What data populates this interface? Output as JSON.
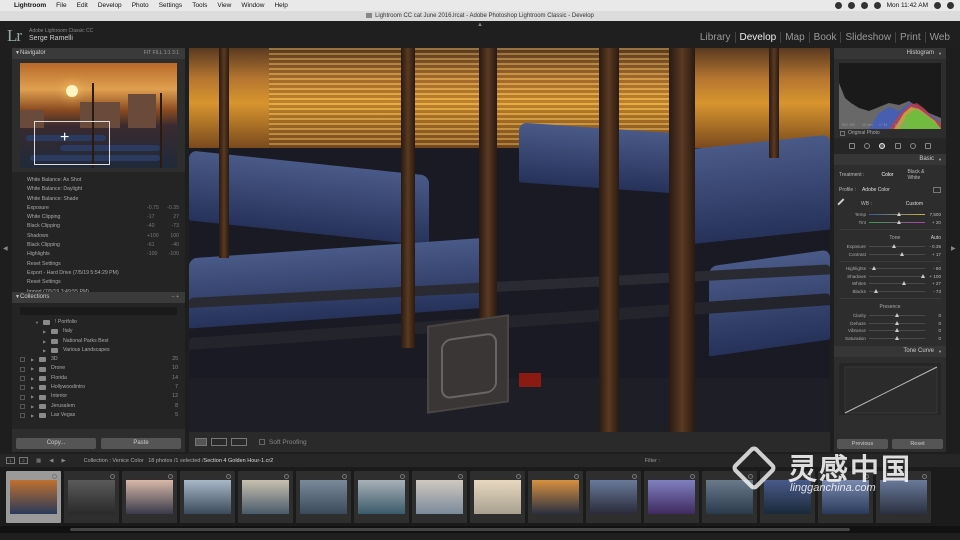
{
  "menubar": {
    "app": "Lightroom",
    "items": [
      "File",
      "Edit",
      "Develop",
      "Photo",
      "Settings",
      "Tools",
      "View",
      "Window",
      "Help"
    ],
    "clock": "Mon 11:42 AM"
  },
  "window": {
    "title": "Lightroom CC cat June 2016.lrcat - Adobe Photoshop Lightroom Classic - Develop"
  },
  "identity": {
    "logo": "Lr",
    "product": "Adobe Lightroom Classic CC",
    "user": "Serge Ramelli"
  },
  "modules": [
    "Library",
    "Develop",
    "Map",
    "Book",
    "Slideshow",
    "Print",
    "Web"
  ],
  "active_module": "Develop",
  "navigator": {
    "title": "Navigator",
    "zoom_options": "FIT  FILL  1:1  3:1"
  },
  "history": [
    {
      "label": "White Balance: As Shot",
      "a": "",
      "b": ""
    },
    {
      "label": "White Balance: Daylight",
      "a": "",
      "b": ""
    },
    {
      "label": "White Balance: Shade",
      "a": "",
      "b": ""
    },
    {
      "label": "Exposure",
      "a": "-0.75",
      "b": "-0.35"
    },
    {
      "label": "White Clipping",
      "a": "-17",
      "b": "27"
    },
    {
      "label": "Black Clipping",
      "a": "-40",
      "b": "-73"
    },
    {
      "label": "Shadows",
      "a": "+100",
      "b": "100"
    },
    {
      "label": "Black Clipping",
      "a": "-61",
      "b": "-40"
    },
    {
      "label": "Highlights",
      "a": "-100",
      "b": "-100"
    },
    {
      "label": "Reset Settings",
      "a": "",
      "b": ""
    },
    {
      "label": "Export - Hard Drive (7/5/19 5:54:29 PM)",
      "a": "",
      "b": ""
    },
    {
      "label": "Reset Settings",
      "a": "",
      "b": ""
    },
    {
      "label": "Import (7/5/19 3:49:55 PM)",
      "a": "",
      "b": ""
    }
  ],
  "collections": {
    "title": "Collections",
    "items": [
      {
        "label": "! Portfolio",
        "count": "",
        "level": 0
      },
      {
        "label": "Italy",
        "count": "",
        "level": 1
      },
      {
        "label": "National Parks Best",
        "count": "",
        "level": 1
      },
      {
        "label": "Various Landscapes",
        "count": "",
        "level": 1
      },
      {
        "label": "3D",
        "count": "25",
        "level": 1
      },
      {
        "label": "Drone",
        "count": "10",
        "level": 1
      },
      {
        "label": "Florida",
        "count": "14",
        "level": 1
      },
      {
        "label": "Hollywoodintro",
        "count": "7",
        "level": 1
      },
      {
        "label": "Interior",
        "count": "12",
        "level": 1
      },
      {
        "label": "Jerusalem",
        "count": "8",
        "level": 1
      },
      {
        "label": "Las Vegas",
        "count": "5",
        "level": 1
      }
    ]
  },
  "left_buttons": {
    "copy": "Copy...",
    "paste": "Paste"
  },
  "toolbar": {
    "soft_proofing": "Soft Proofing"
  },
  "histogram": {
    "title": "Histogram",
    "iso": "ISO 160",
    "focal": "24 mm",
    "aperture": "f / 14",
    "shutter": "1/60 SEC",
    "original_photo": "Original Photo"
  },
  "basic": {
    "title": "Basic",
    "treatment_label": "Treatment :",
    "treatment_color": "Color",
    "treatment_bw": "Black & White",
    "profile_label": "Profile :",
    "profile_value": "Adobe Color",
    "wb_label": "WB :",
    "wb_value": "Custom",
    "temp": {
      "label": "Temp",
      "value": "7,500",
      "pos": 0.55
    },
    "tint": {
      "label": "Tint",
      "value": "+ 20",
      "pos": 0.55
    },
    "tone_label": "Tone",
    "tone_auto": "Auto",
    "exposure": {
      "label": "Exposure",
      "value": "- 0.35",
      "pos": 0.46
    },
    "contrast": {
      "label": "Contrast",
      "value": "+ 17",
      "pos": 0.6
    },
    "highlights": {
      "label": "Highlights",
      "value": "- 80",
      "pos": 0.1
    },
    "shadows": {
      "label": "Shadows",
      "value": "+ 100",
      "pos": 0.98
    },
    "whites": {
      "label": "Whites",
      "value": "+ 27",
      "pos": 0.64
    },
    "blacks": {
      "label": "Blacks",
      "value": "- 73",
      "pos": 0.14
    },
    "presence_label": "Presence",
    "clarity": {
      "label": "Clarity",
      "value": "0",
      "pos": 0.5
    },
    "dehaze": {
      "label": "Dehaze",
      "value": "0",
      "pos": 0.5
    },
    "vibrance": {
      "label": "Vibrance",
      "value": "0",
      "pos": 0.5
    },
    "saturation": {
      "label": "Saturation",
      "value": "0",
      "pos": 0.5
    }
  },
  "tone_curve": {
    "title": "Tone Curve"
  },
  "right_buttons": {
    "previous": "Previous",
    "reset": "Reset"
  },
  "filmstrip_bar": {
    "page1": "1",
    "page2": "2",
    "collection": "Collection : Venice Color",
    "info": "18 photos /1 selected /",
    "file": "Section 4 Golden Hour-1.cr2",
    "filter": "Filter :"
  },
  "filmstrip": {
    "thumbs": [
      {
        "dots": "",
        "colors": [
          "#c07030",
          "#2a3a5a"
        ]
      },
      {
        "dots": "",
        "colors": [
          "#5a5a5a",
          "#2a2a2a"
        ]
      },
      {
        "dots": "",
        "colors": [
          "#d8b8a8",
          "#3a3a4a"
        ]
      },
      {
        "dots": "",
        "colors": [
          "#a8b8c8",
          "#3a4a5a"
        ]
      },
      {
        "dots": "",
        "colors": [
          "#c8c0b0",
          "#4a5a6a"
        ]
      },
      {
        "dots": "",
        "colors": [
          "#7a8a9a",
          "#3a4a5a"
        ]
      },
      {
        "dots": "",
        "colors": [
          "#a8b0b8",
          "#3a5a6a"
        ]
      },
      {
        "dots": "",
        "colors": [
          "#d0c8c0",
          "#7a8a9a"
        ]
      },
      {
        "dots": "",
        "colors": [
          "#e8d8c0",
          "#a8a090"
        ]
      },
      {
        "dots": "",
        "colors": [
          "#d89040",
          "#2a3040"
        ]
      },
      {
        "dots": "",
        "colors": [
          "#6a7a9a",
          "#2a2a3a"
        ]
      },
      {
        "dots": "",
        "colors": [
          "#8080c0",
          "#402a60"
        ]
      },
      {
        "dots": "",
        "colors": [
          "#6a7a8a",
          "#2a3a4a"
        ]
      },
      {
        "dots": "",
        "colors": [
          "#4a5a8a",
          "#1a2a3a"
        ]
      },
      {
        "dots": "",
        "colors": [
          "#7a8ab0",
          "#2a3a5a"
        ]
      },
      {
        "dots": "",
        "colors": [
          "#6a7a9a",
          "#2a3040"
        ]
      }
    ]
  },
  "watermark": {
    "chinese": "灵感中国",
    "url": "lingganchina.com"
  }
}
